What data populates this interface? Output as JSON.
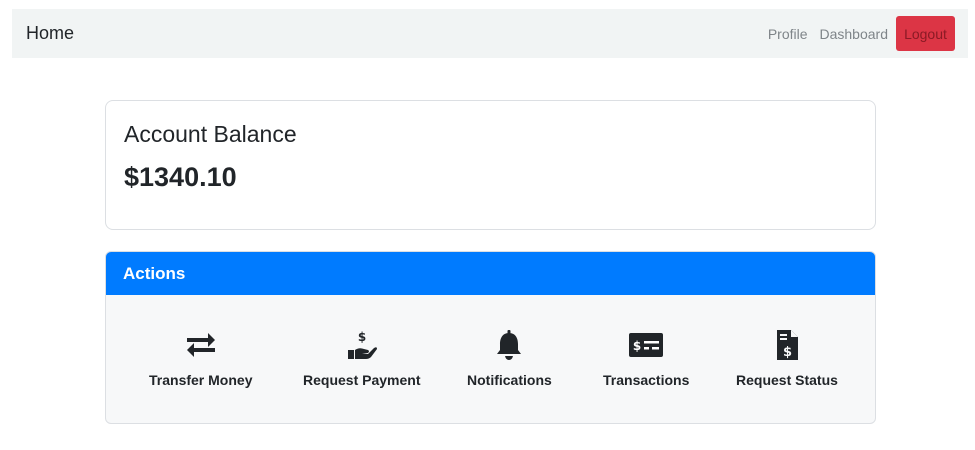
{
  "navbar": {
    "brand": "Home",
    "links": [
      "Profile",
      "Dashboard"
    ],
    "logout": "Logout"
  },
  "balance": {
    "title": "Account Balance",
    "amount": "$1340.10"
  },
  "actions": {
    "title": "Actions",
    "items": [
      {
        "label": "Transfer Money",
        "icon": "exchange-arrows-icon"
      },
      {
        "label": "Request Payment",
        "icon": "hand-dollar-icon"
      },
      {
        "label": "Notifications",
        "icon": "bell-icon"
      },
      {
        "label": "Transactions",
        "icon": "money-check-icon"
      },
      {
        "label": "Request Status",
        "icon": "invoice-dollar-icon"
      }
    ]
  },
  "colors": {
    "primary": "#007bff",
    "danger": "#dc3545",
    "navbar_bg": "#f1f4f4"
  }
}
